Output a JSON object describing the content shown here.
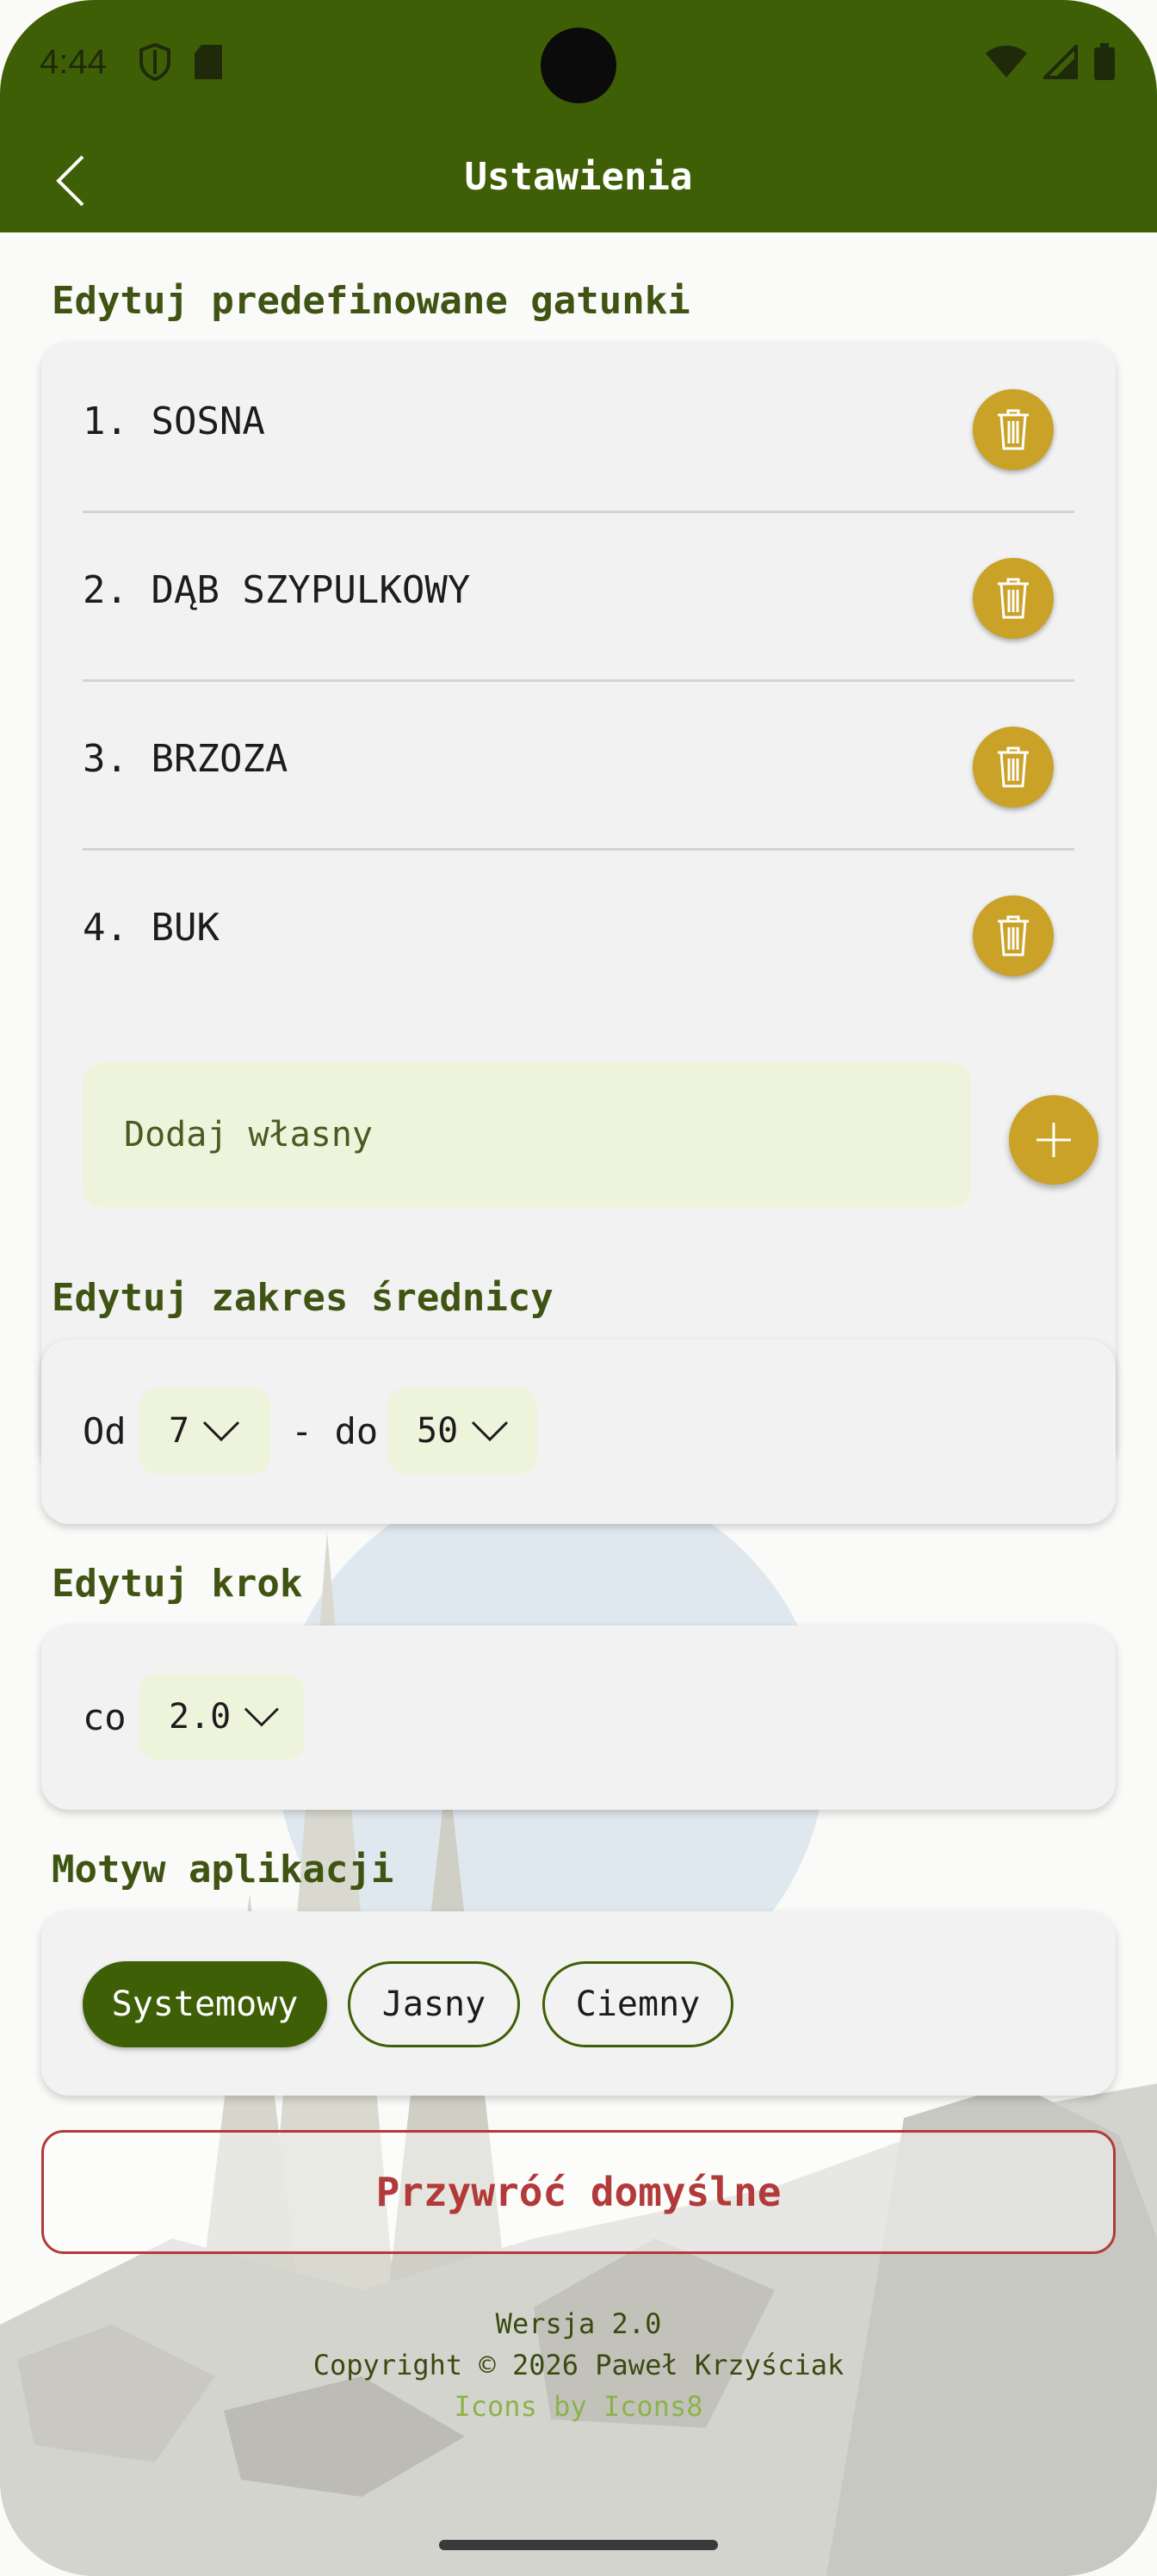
{
  "status_bar": {
    "time": "4:44",
    "icons_left": [
      "shield-icon",
      "sd-card-icon"
    ],
    "icons_right": [
      "wifi-icon",
      "cellular-signal-icon",
      "battery-icon"
    ]
  },
  "app_bar": {
    "title": "Ustawienia",
    "back_icon": "arrow-back-icon"
  },
  "species_section": {
    "title": "Edytuj predefinowane gatunki",
    "items": [
      {
        "label": "1. SOSNA"
      },
      {
        "label": "2. DĄB SZYPULKOWY"
      },
      {
        "label": "3. BRZOZA"
      },
      {
        "label": "4. BUK"
      }
    ],
    "add_placeholder": "Dodaj własny",
    "add_value": "",
    "delete_icon": "trash-icon",
    "add_icon": "plus-icon"
  },
  "diameter_section": {
    "title": "Edytuj zakres średnicy",
    "from_label": "Od",
    "from_value": "7",
    "separator_label": "- do",
    "to_value": "50"
  },
  "step_section": {
    "title": "Edytuj krok",
    "label": "co",
    "value": "2.0"
  },
  "theme_section": {
    "title": "Motyw aplikacji",
    "options": [
      {
        "label": "Systemowy",
        "selected": true
      },
      {
        "label": "Jasny",
        "selected": false
      },
      {
        "label": "Ciemny",
        "selected": false
      }
    ]
  },
  "reset_button": {
    "label": "Przywróć domyślne"
  },
  "footer": {
    "version": "Wersja 2.0",
    "copyright": "Copyright © 2026 Paweł Krzyściak",
    "icons_credit": "Icons by Icons8"
  },
  "colors": {
    "primary": "#3f5f06",
    "accent": "#c9a227",
    "danger": "#b23a3a",
    "card": "#f2f2f2",
    "input": "#eef4dc"
  }
}
